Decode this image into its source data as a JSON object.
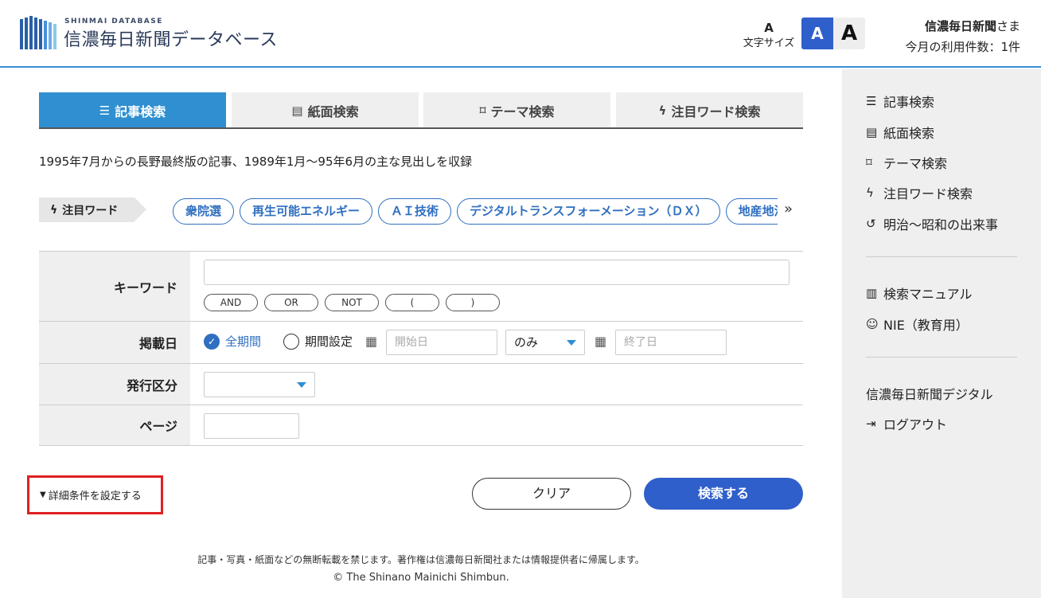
{
  "header": {
    "logo_small": "SHINMAI DATABASE",
    "logo_title": "信濃毎日新聞データベース",
    "fontsize_icon": "A",
    "fontsize_label": "文字サイズ",
    "font_small": "A",
    "font_large": "A",
    "user_name": "信濃毎日新聞",
    "user_suffix": "さま",
    "usage": "今月の利用件数：1件"
  },
  "tabs": [
    {
      "label": "記事検索",
      "icon": "list-icon"
    },
    {
      "label": "紙面検索",
      "icon": "newspaper-icon"
    },
    {
      "label": "テーマ検索",
      "icon": "bookmark-icon"
    },
    {
      "label": "注目ワード検索",
      "icon": "lightning-icon"
    }
  ],
  "description": "1995年7月からの長野最終版の記事、1989年1月〜95年6月の主な見出しを収録",
  "attention": {
    "label": "注目ワード",
    "words": [
      "衆院選",
      "再生可能エネルギー",
      "ＡＩ技術",
      "デジタルトランスフォーメーション（ＤＸ）",
      "地産地消"
    ],
    "more": "»"
  },
  "form": {
    "keyword_label": "キーワード",
    "keyword_value": "",
    "operators": [
      "AND",
      "OR",
      "NOT",
      "(",
      ")"
    ],
    "date_label": "掲載日",
    "all_period": "全期間",
    "period_set": "期間設定",
    "start_placeholder": "開始日",
    "mode_value": "のみ",
    "end_placeholder": "終了日",
    "issue_label": "発行区分",
    "issue_value": "",
    "page_label": "ページ",
    "page_value": ""
  },
  "actions": {
    "detail": "詳細条件を設定する",
    "clear": "クリア",
    "search": "検索する"
  },
  "sidebar": {
    "items": [
      {
        "label": "記事検索"
      },
      {
        "label": "紙面検索"
      },
      {
        "label": "テーマ検索"
      },
      {
        "label": "注目ワード検索"
      },
      {
        "label": "明治〜昭和の出来事"
      },
      {
        "label": "検索マニュアル"
      },
      {
        "label": "NIE（教育用）"
      },
      {
        "label": "信濃毎日新聞デジタル"
      },
      {
        "label": "ログアウト"
      }
    ]
  },
  "footer": {
    "notice": "記事・写真・紙面などの無断転載を禁じます。著作権は信濃毎日新聞社または情報提供者に帰属します。",
    "copyright": "© The Shinano Mainichi Shimbun."
  },
  "colors": {
    "accent": "#2f8fd1",
    "primary": "#2f5fca",
    "highlight": "#e02020"
  }
}
